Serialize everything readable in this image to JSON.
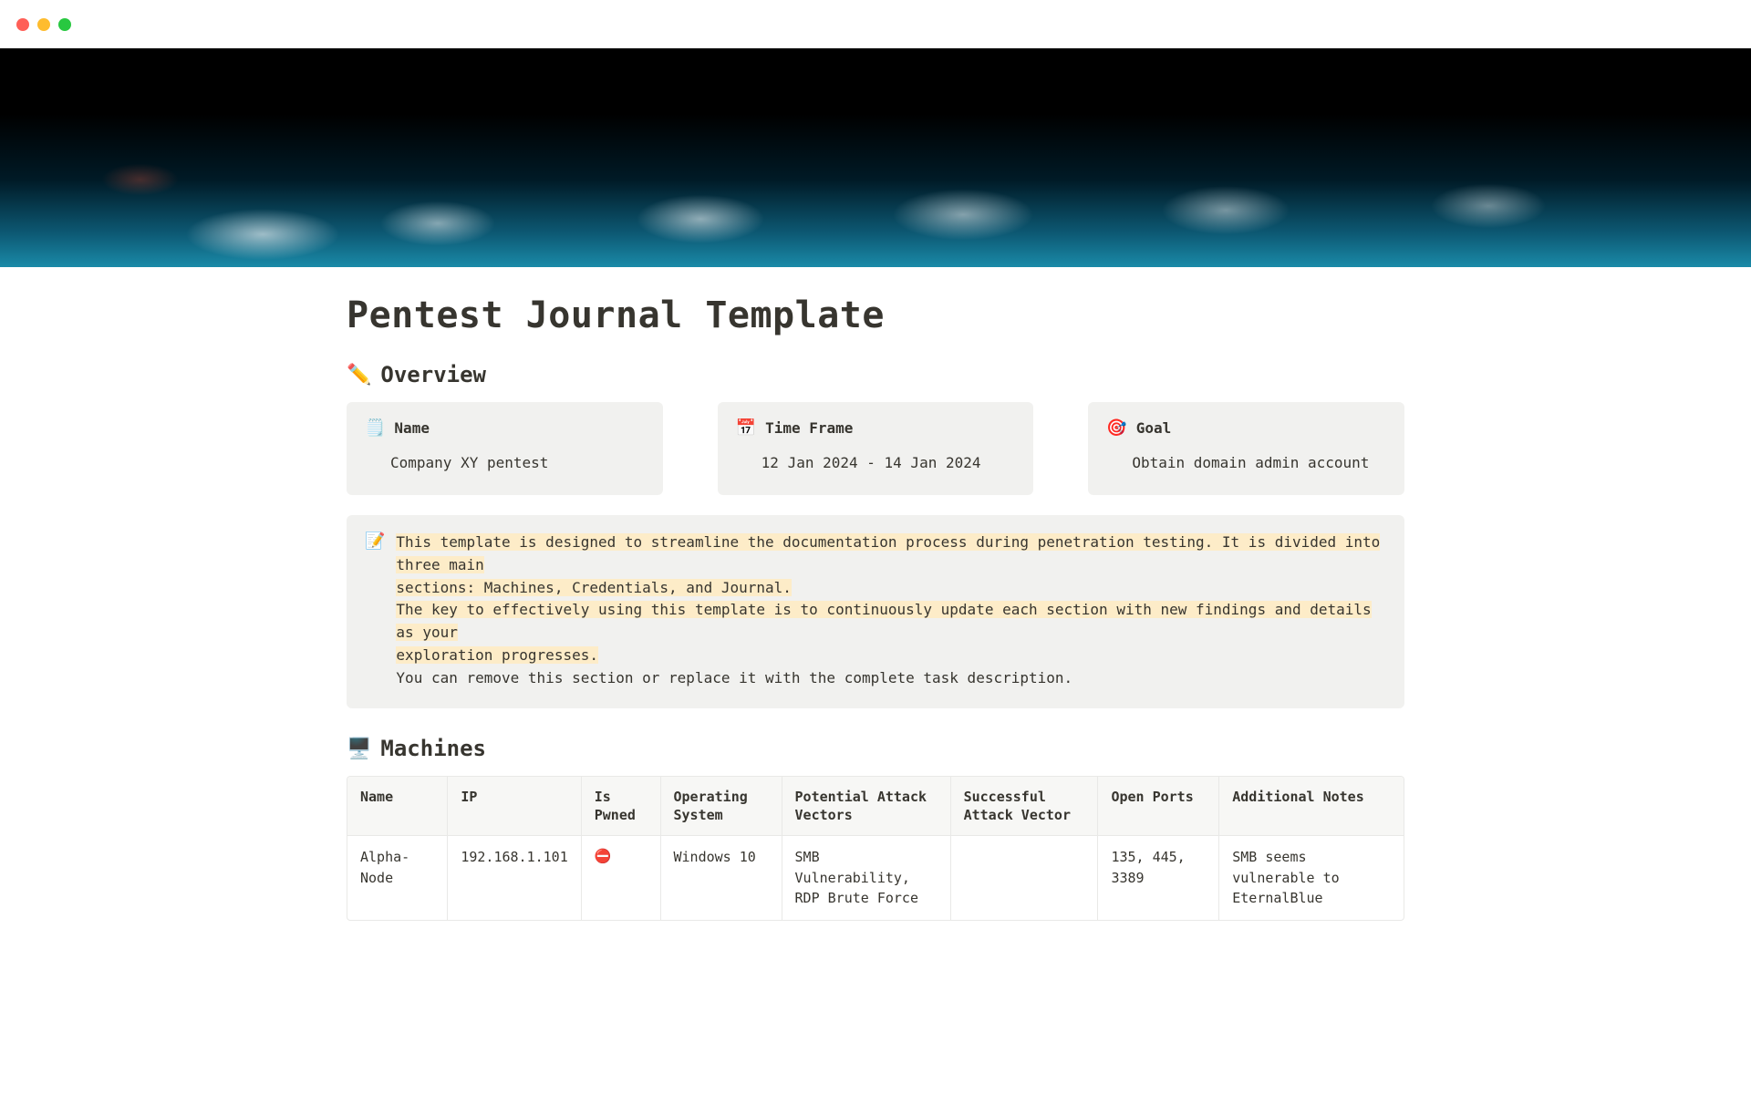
{
  "page": {
    "title": "Pentest Journal Template"
  },
  "overview": {
    "heading_icon": "✏️",
    "heading": "Overview",
    "cards": {
      "name": {
        "icon": "🗒️",
        "label": "Name",
        "value": "Company XY pentest"
      },
      "time": {
        "icon": "📅",
        "label": "Time Frame",
        "value": "12 Jan 2024 - 14 Jan 2024"
      },
      "goal": {
        "icon": "🎯",
        "label": "Goal",
        "value": "Obtain domain admin account"
      }
    },
    "callout": {
      "icon": "📝",
      "line1a": "This template is designed to streamline the documentation process during penetration testing. It is divided into three main",
      "line1b": "sections: Machines, Credentials, and Journal.",
      "line2a": "The key to effectively using this template is to continuously update each section with new findings and details as your",
      "line2b": "exploration progresses.",
      "line3": "You can remove this section or replace it with the complete task description."
    }
  },
  "machines": {
    "heading_icon": "🖥️",
    "heading": "Machines",
    "columns": {
      "name": "Name",
      "ip": "IP",
      "pwned": "Is Pwned",
      "os": "Operating System",
      "potential": "Potential Attack Vectors",
      "successful": "Successful Attack Vector",
      "ports": "Open Ports",
      "notes": "Additional Notes"
    },
    "rows": [
      {
        "name": "Alpha-Node",
        "ip": "192.168.1.101",
        "pwned": "⛔",
        "os": "Windows 10",
        "potential": "SMB Vulnerability, RDP Brute Force",
        "successful": "",
        "ports": "135, 445, 3389",
        "notes": "SMB seems vulnerable to EternalBlue"
      }
    ]
  }
}
